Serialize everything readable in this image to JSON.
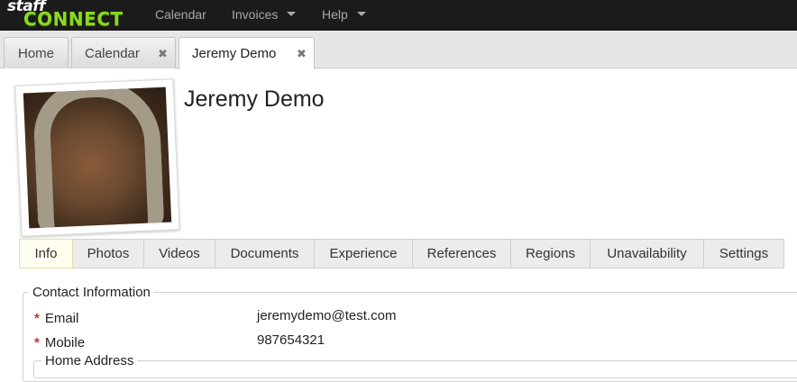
{
  "brand": {
    "line1": "staff",
    "line2": "CONNECT"
  },
  "nav": {
    "calendar": "Calendar",
    "invoices": "Invoices",
    "help": "Help"
  },
  "tabs": [
    {
      "label": "Home"
    },
    {
      "label": "Calendar",
      "close": "✖"
    },
    {
      "label": "Jeremy Demo",
      "close": "✖"
    }
  ],
  "profile": {
    "name": "Jeremy Demo"
  },
  "section_tabs": [
    "Info",
    "Photos",
    "Videos",
    "Documents",
    "Experience",
    "References",
    "Regions",
    "Unavailability",
    "Settings"
  ],
  "contact": {
    "legend": "Contact Information",
    "required_mark": "*",
    "email_label": "Email",
    "email_value": "jeremydemo@test.com",
    "mobile_label": "Mobile",
    "mobile_value": "987654321",
    "home_address_legend": "Home Address"
  },
  "colors": {
    "navbar": "#1b1b1b",
    "brand_green": "#8bd91f",
    "required": "#c0392b",
    "active_section_tab": "#fffdf0"
  },
  "icons": {
    "dropdown": "caret-down-icon",
    "tab_close": "close-icon"
  }
}
